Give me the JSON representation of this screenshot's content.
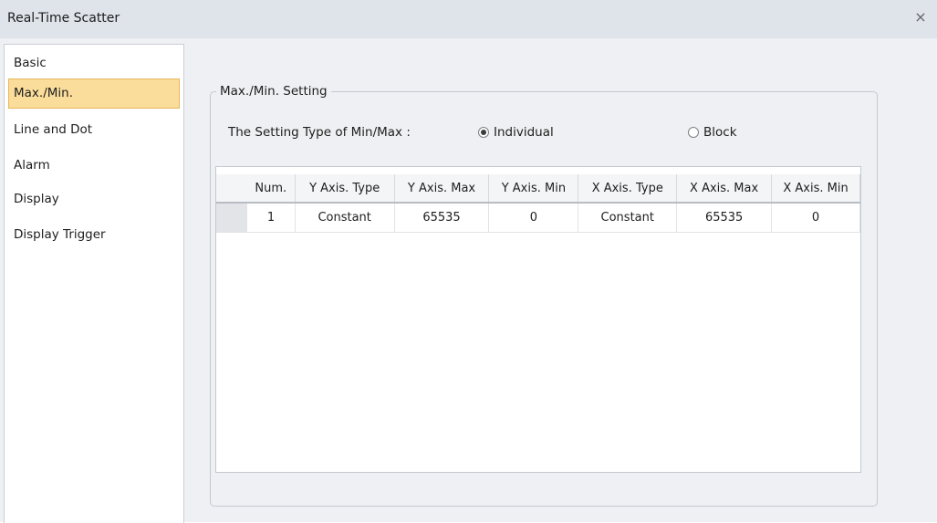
{
  "window": {
    "title": "Real-Time Scatter",
    "close_glyph": "×"
  },
  "sidebar": {
    "items": [
      {
        "label": "Basic"
      },
      {
        "label": "Max./Min."
      },
      {
        "label": "Line and Dot"
      },
      {
        "label": "Alarm"
      },
      {
        "label": "Display"
      },
      {
        "label": "Display Trigger"
      }
    ],
    "selected": "Max./Min."
  },
  "settings": {
    "group_label": "Max./Min. Setting",
    "type_label": "The Setting Type of Min/Max :",
    "options": [
      {
        "label": "Individual",
        "checked": true
      },
      {
        "label": "Block",
        "checked": false
      }
    ]
  },
  "table": {
    "columns": [
      "Num.",
      "Y Axis. Type",
      "Y Axis. Max",
      "Y Axis. Min",
      "X Axis. Type",
      "X Axis. Max",
      "X Axis. Min"
    ],
    "rows": [
      [
        "1",
        "Constant",
        "65535",
        "0",
        "Constant",
        "65535",
        "0"
      ]
    ]
  },
  "colors": {
    "selected_bg": "#fbdd9b",
    "selected_border": "#e8b65a",
    "titlebar_bg": "#dfe3ea"
  }
}
